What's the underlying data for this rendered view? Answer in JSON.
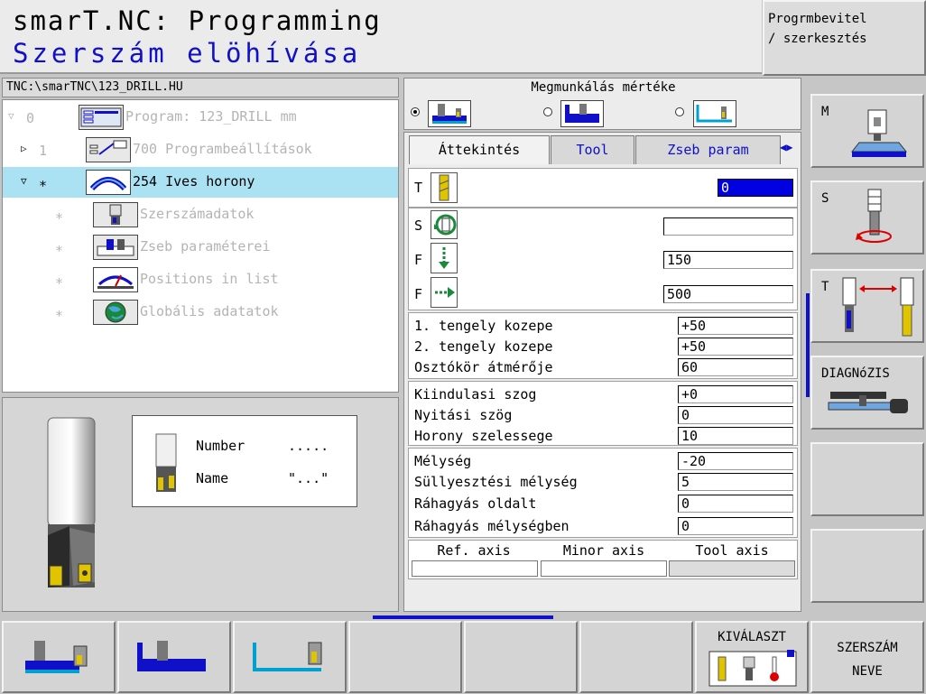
{
  "header": {
    "title": "smarT.NC: Programming",
    "subtitle": "Szerszám elöhívása",
    "mode_line1": "Progrmbevitel",
    "mode_line2": "/ szerkesztés"
  },
  "tree": {
    "path": "TNC:\\smarTNC\\123_DRILL.HU",
    "rows": [
      {
        "twisty": "▽",
        "num": "0",
        "label": "Program: 123_DRILL mm",
        "icon": "program-icon"
      },
      {
        "twisty": "▷",
        "num": "1",
        "label": "700 Programbeállítások",
        "icon": "program-settings-icon"
      },
      {
        "twisty": "▽",
        "num": "∗",
        "label": "254 Ives horony",
        "icon": "circular-slot-icon"
      },
      {
        "twisty": "",
        "num": "∗",
        "label": "Szerszámadatok",
        "icon": "tool-data-icon"
      },
      {
        "twisty": "",
        "num": "∗",
        "label": "Zseb paraméterei",
        "icon": "pocket-params-icon"
      },
      {
        "twisty": "",
        "num": "∗",
        "label": "Positions in list",
        "icon": "positions-icon"
      },
      {
        "twisty": "",
        "num": "∗",
        "label": "Globális adatatok",
        "icon": "global-data-icon"
      }
    ]
  },
  "preview": {
    "number_label": "Number",
    "number_value": ".....",
    "name_label": "Name",
    "name_value": "\"...\""
  },
  "machining": {
    "title": "Megmunkálás mértéke",
    "options": [
      "roughing-finishing",
      "roughing",
      "finishing"
    ],
    "selected": 0
  },
  "tabs": [
    {
      "label": "Áttekintés",
      "active": true
    },
    {
      "label": "Tool",
      "active": false
    },
    {
      "label": "Zseb param",
      "active": false
    }
  ],
  "form": {
    "tool": {
      "label": "T",
      "value": "0"
    },
    "spindle": {
      "label": "S",
      "value": ""
    },
    "feed_plunge": {
      "label": "F",
      "value": "150"
    },
    "feed_mill": {
      "label": "F",
      "value": "500"
    },
    "center_axis1": {
      "label": "1. tengely kozepe",
      "value": "+50"
    },
    "center_axis2": {
      "label": "2. tengely kozepe",
      "value": "+50"
    },
    "pitch_diameter": {
      "label": "Osztókör átmérője",
      "value": "60"
    },
    "start_angle": {
      "label": "Kiindulasi szog",
      "value": "+0"
    },
    "opening_angle": {
      "label": "Nyitási szög",
      "value": "0"
    },
    "slot_width": {
      "label": "Horony szelessege",
      "value": "10"
    },
    "depth": {
      "label": "Mélység",
      "value": "-20"
    },
    "plunge_depth": {
      "label": "Süllyesztési mélység",
      "value": "5"
    },
    "side_allowance": {
      "label": "Ráhagyás oldalt",
      "value": "0"
    },
    "floor_allowance": {
      "label": "Ráhagyás mélységben",
      "value": "0"
    }
  },
  "axes": {
    "headers": [
      "Ref. axis",
      "Minor axis",
      "Tool axis"
    ]
  },
  "right_softkeys": [
    {
      "label": "M",
      "icon": "machine-table-icon"
    },
    {
      "label": "S",
      "icon": "spindle-rotation-icon"
    },
    {
      "label": "T",
      "icon": "tool-change-icon"
    },
    {
      "label": "DIAGNóZIS",
      "icon": "diagnosis-icon"
    },
    {
      "label": "",
      "icon": ""
    },
    {
      "label": "",
      "icon": ""
    }
  ],
  "bottom_softkeys": [
    {
      "label": "",
      "icon": "roughing-finishing-icon"
    },
    {
      "label": "",
      "icon": "roughing-icon"
    },
    {
      "label": "",
      "icon": "finishing-icon"
    },
    {
      "label": "",
      "icon": ""
    },
    {
      "label": "",
      "icon": ""
    },
    {
      "label": "",
      "icon": ""
    },
    {
      "label": "KIVÁLASZT",
      "icon": "select-tool-icon"
    },
    {
      "label": "SZERSZÁM NEVE",
      "label1": "SZERSZÁM",
      "label2": "NEVE",
      "icon": ""
    }
  ],
  "colors": {
    "accent_blue": "#1010c8",
    "selected_row": "#aae2f4",
    "active_field": "#0000e0",
    "dim_text": "#b4b4b4"
  }
}
